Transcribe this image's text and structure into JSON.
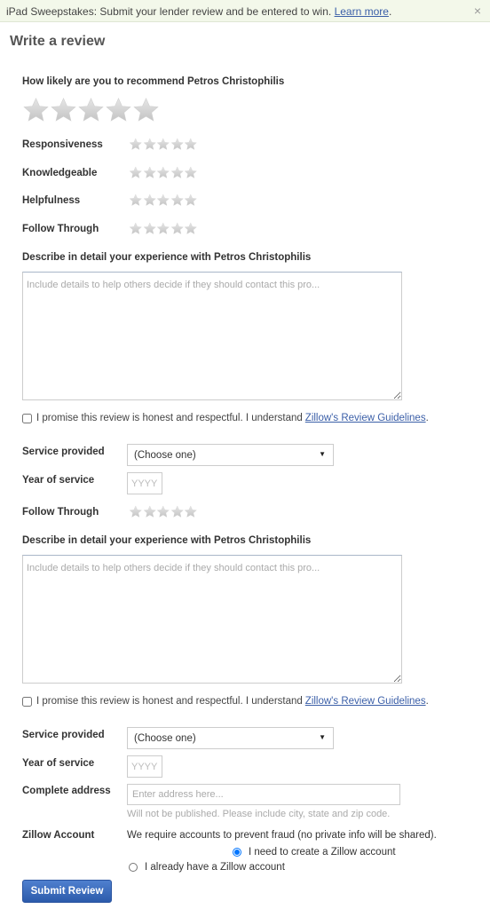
{
  "banner": {
    "text": "iPad Sweepstakes: Submit your lender review and be entered to win.",
    "link": "Learn more",
    "close_icon": "×"
  },
  "title": "Write a review",
  "recommend_label": "How likely are you to recommend Petros Christophilis",
  "recommend_rating": {
    "value": 0,
    "max": 5
  },
  "ratings_top": [
    {
      "label": "Responsiveness",
      "value": 0,
      "max": 5
    },
    {
      "label": "Knowledgeable",
      "value": 0,
      "max": 5
    },
    {
      "label": "Helpfulness",
      "value": 0,
      "max": 5
    },
    {
      "label": "Follow Through",
      "value": 0,
      "max": 5
    }
  ],
  "section1": {
    "describe_label": "Describe in detail your experience with Petros Christophilis",
    "textarea_placeholder": "Include details to help others decide if they should contact this pro...",
    "promise_text": "I promise this review is honest and respectful. I understand",
    "promise_link": "Zillow's Review Guidelines",
    "promise_end": ".",
    "service_label": "Service provided",
    "service_value": "(Choose one)",
    "year_label": "Year of service",
    "year_placeholder": "YYYY",
    "follow_label": "Follow Through"
  },
  "section2": {
    "describe_label": "Describe in detail your experience with Petros Christophilis",
    "textarea_placeholder": "Include details to help others decide if they should contact this pro...",
    "promise_text": "I promise this review is honest and respectful. I understand",
    "promise_link": "Zillow's Review Guidelines",
    "promise_end": ".",
    "service_label": "Service provided",
    "service_value": "(Choose one)",
    "year_label": "Year of service",
    "year_placeholder": "YYYY",
    "address_label": "Complete address",
    "address_placeholder": "Enter address here...",
    "address_hint": "Will not be published. Please include city, state and zip code.",
    "account_label": "Zillow Account",
    "account_text": "We require accounts to prevent fraud (no private info will be shared).",
    "radio_create": "I need to create a Zillow account",
    "radio_existing": "I already have a Zillow account",
    "submit_label": "Submit Review"
  }
}
